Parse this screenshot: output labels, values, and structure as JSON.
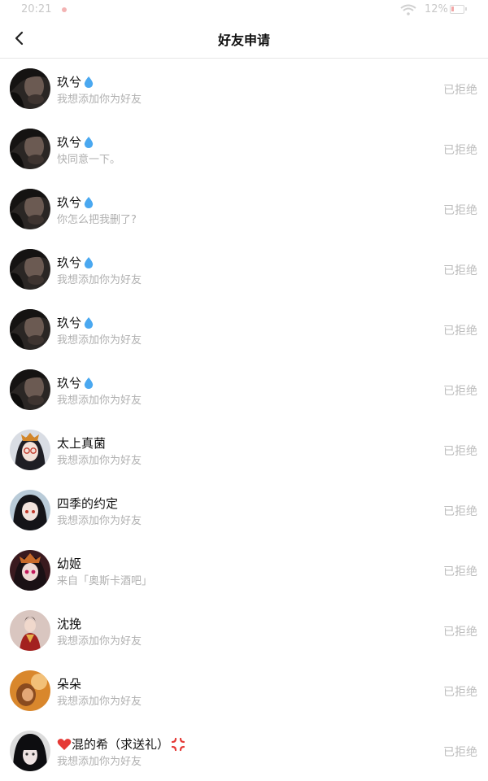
{
  "status_bar": {
    "time": "20:21",
    "battery": "12%"
  },
  "header": {
    "title": "好友申请"
  },
  "requests": [
    {
      "name": "玖兮",
      "name_icon": "water-drop",
      "message": "我想添加你为好友",
      "status": "已拒绝",
      "avatar": "dark-selfie"
    },
    {
      "name": "玖兮",
      "name_icon": "water-drop",
      "message": "快同意一下。",
      "status": "已拒绝",
      "avatar": "dark-selfie"
    },
    {
      "name": "玖兮",
      "name_icon": "water-drop",
      "message": "你怎么把我删了?",
      "status": "已拒绝",
      "avatar": "dark-selfie"
    },
    {
      "name": "玖兮",
      "name_icon": "water-drop",
      "message": "我想添加你为好友",
      "status": "已拒绝",
      "avatar": "dark-selfie"
    },
    {
      "name": "玖兮",
      "name_icon": "water-drop",
      "message": "我想添加你为好友",
      "status": "已拒绝",
      "avatar": "dark-selfie"
    },
    {
      "name": "玖兮",
      "name_icon": "water-drop",
      "message": "我想添加你为好友",
      "status": "已拒绝",
      "avatar": "dark-selfie"
    },
    {
      "name": "太上真菌",
      "message": "我想添加你为好友",
      "status": "已拒绝",
      "avatar": "anime-glasses"
    },
    {
      "name": "四季的约定",
      "message": "我想添加你为好友",
      "status": "已拒绝",
      "avatar": "anime-dark-hair"
    },
    {
      "name": "幼姬",
      "message": "来自「奥斯卡酒吧」",
      "status": "已拒绝",
      "avatar": "anime-red"
    },
    {
      "name": "沈挽",
      "message": "我想添加你为好友",
      "status": "已拒绝",
      "avatar": "costume-red"
    },
    {
      "name": "朵朵",
      "message": "我想添加你为好友",
      "status": "已拒绝",
      "avatar": "orange-photo"
    },
    {
      "name": "混的希（求送礼）",
      "name_prefix_icon": "red-heart",
      "name_suffix_icon": "anger-symbol",
      "message": "我想添加你为好友",
      "status": "已拒绝",
      "avatar": "bangs-girl"
    }
  ],
  "colors": {
    "status_text": "#bdbdbd",
    "message_text": "#b0b0b0",
    "divider": "#e6e6e6",
    "drop_blue": "#4aa8f0",
    "heart_red": "#e53935"
  }
}
